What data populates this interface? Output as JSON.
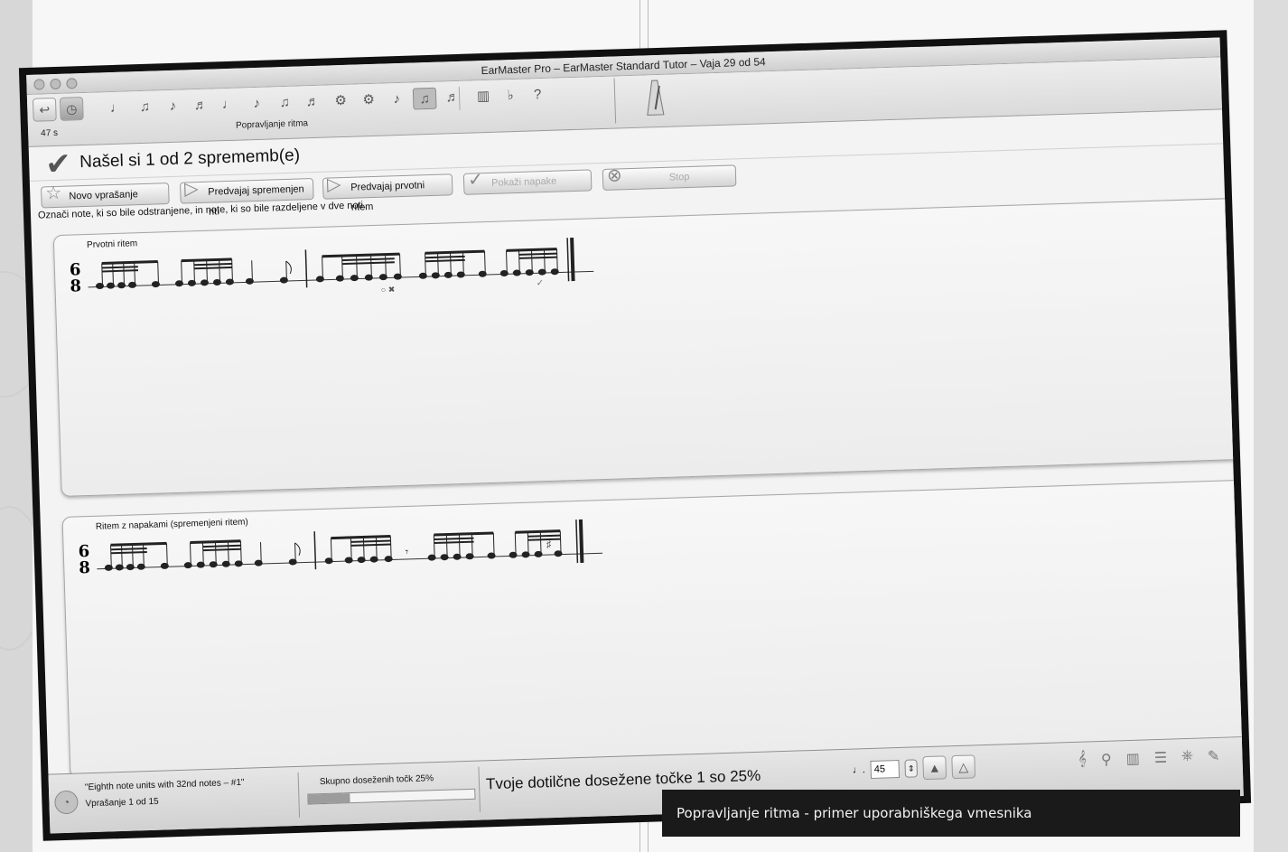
{
  "window": {
    "title": "EarMaster Pro – EarMaster Standard Tutor – Vaja 29 od 54"
  },
  "toolbar": {
    "timer": "47 s",
    "exercise_caption": "Popravljanje ritma"
  },
  "status": {
    "found_text": "Našel si 1 od 2 sprememb(e)"
  },
  "actions": {
    "new_question": "Novo vprašanje",
    "play_changed": "Predvajaj spremenjen ritı",
    "play_original": "Predvajaj prvotni ritem",
    "show_errors": "Pokaži napake",
    "stop": "Stop"
  },
  "instruction": "Označi note, ki so bile odstranjene, in note, ki so bile razdeljene v dve noti.",
  "panel_original": {
    "label": "Prvotni ritem",
    "time_sig_top": "6",
    "time_sig_bottom": "8"
  },
  "panel_changed": {
    "label": "Ritem z napakami (spremenjeni ritem)",
    "time_sig_top": "6",
    "time_sig_bottom": "8"
  },
  "bottom": {
    "exercise_name": "\"Eighth note units with 32nd notes – #1\"",
    "question_count": "Vprašanje 1 od 15",
    "total_points_label": "Skupno doseženih točk 25%",
    "total_points_progress": 0.25,
    "current_points": "Tvoje dotilčne dosežene točke 1 so 25%",
    "tempo_value": "45"
  },
  "caption": "Popravljanje ritma - primer uporabniškega vmesnika"
}
